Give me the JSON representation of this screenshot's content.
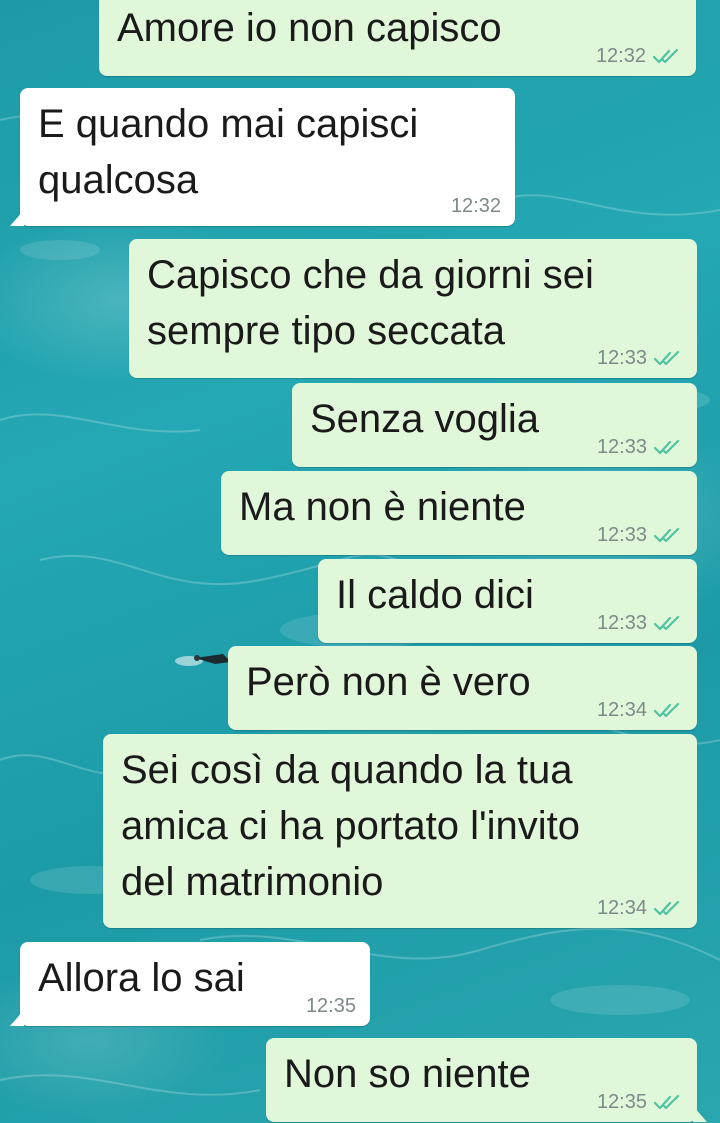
{
  "chat": {
    "messages": [
      {
        "text": "Amore io non capisco",
        "time": "12:32",
        "direction": "outgoing",
        "status": "read"
      },
      {
        "text": "E quando mai capisci\nqualcosa",
        "time": "12:32",
        "direction": "incoming"
      },
      {
        "text": "Capisco che da giorni sei\nsempre tipo seccata",
        "time": "12:33",
        "direction": "outgoing",
        "status": "read"
      },
      {
        "text": "Senza voglia",
        "time": "12:33",
        "direction": "outgoing",
        "status": "read"
      },
      {
        "text": "Ma non è niente",
        "time": "12:33",
        "direction": "outgoing",
        "status": "read"
      },
      {
        "text": "Il caldo dici",
        "time": "12:33",
        "direction": "outgoing",
        "status": "read"
      },
      {
        "text": "Però non è vero",
        "time": "12:34",
        "direction": "outgoing",
        "status": "read"
      },
      {
        "text": "Sei così da quando la tua\namica ci ha portato l'invito\ndel matrimonio",
        "time": "12:34",
        "direction": "outgoing",
        "status": "read"
      },
      {
        "text": "Allora lo sai",
        "time": "12:35",
        "direction": "incoming"
      },
      {
        "text": "Non so niente",
        "time": "12:35",
        "direction": "outgoing",
        "status": "read"
      }
    ]
  },
  "colors": {
    "outgoing_bubble": "#e1f7d9",
    "incoming_bubble": "#ffffff",
    "read_tick": "#4fc3a1",
    "wallpaper": "#24a8b3"
  },
  "icons": {
    "read_receipt": "double-check-icon"
  }
}
